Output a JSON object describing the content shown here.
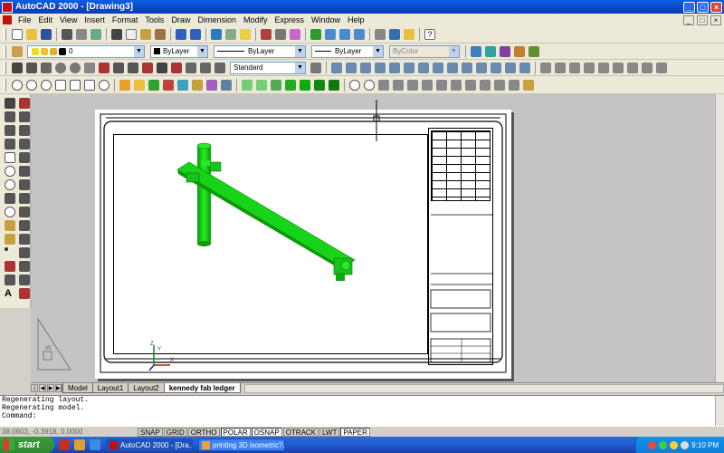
{
  "window": {
    "title": "AutoCAD 2000 - [Drawing3]",
    "min_icon": "minimize-icon",
    "max_icon": "maximize-icon",
    "close_icon": "close-icon"
  },
  "menu": {
    "items": [
      "File",
      "Edit",
      "View",
      "Insert",
      "Format",
      "Tools",
      "Draw",
      "Dimension",
      "Modify",
      "Express",
      "Window",
      "Help"
    ]
  },
  "toolbars": {
    "layer_value": "0",
    "color_value": "ByLayer",
    "linetype_value": "ByLayer",
    "lineweight_value": "ByLayer",
    "plotstyle_value": "ByColor",
    "dimstyle_value": "Standard"
  },
  "layout": {
    "tabs": [
      "Model",
      "Layout1",
      "Layout2",
      "kennedy fab ledger"
    ],
    "active_tab_index": 3
  },
  "command_line": {
    "lines": [
      "Regenerating layout.",
      "Regenerating model."
    ],
    "prompt": "Command:"
  },
  "status": {
    "coordinates": "38.0603, -0.3918, 0.0000",
    "toggles": [
      {
        "label": "SNAP",
        "on": false
      },
      {
        "label": "GRID",
        "on": false
      },
      {
        "label": "ORTHO",
        "on": false
      },
      {
        "label": "POLAR",
        "on": true
      },
      {
        "label": "OSNAP",
        "on": true
      },
      {
        "label": "OTRACK",
        "on": false
      },
      {
        "label": "LWT",
        "on": false
      },
      {
        "label": "PAPER",
        "on": true
      }
    ]
  },
  "taskbar": {
    "start_label": "start",
    "tasks": [
      "AutoCAD 2000 - [Dra...",
      "printing 3D isometric?..."
    ],
    "clock": "9:10 PM"
  },
  "ucs": {
    "x": "X",
    "y": "Y",
    "z": "Z"
  },
  "colors": {
    "model_green": "#15d515",
    "titlebar_blue": "#0a5fe0"
  }
}
